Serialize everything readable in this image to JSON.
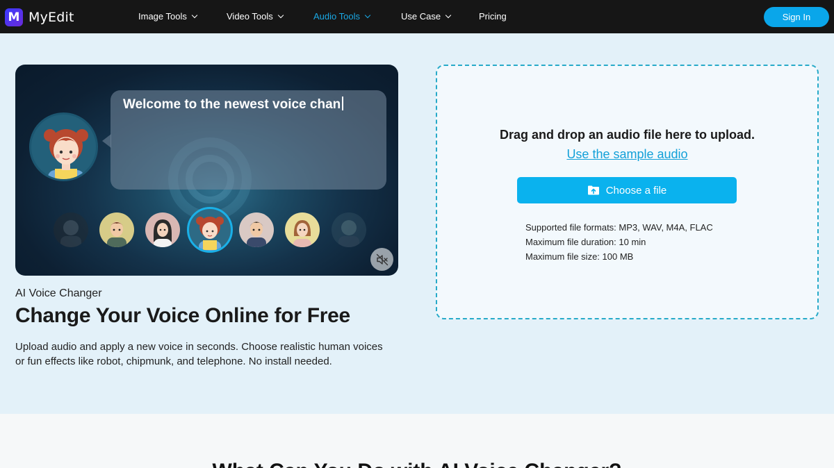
{
  "nav": {
    "logo_text": "MyEdit",
    "logo_letter": "M",
    "items": [
      {
        "label": "Image Tools"
      },
      {
        "label": "Video Tools"
      },
      {
        "label": "Audio Tools"
      },
      {
        "label": "Use Case"
      },
      {
        "label": "Pricing"
      }
    ],
    "active_item": "Audio Tools",
    "signin_label": "Sign In"
  },
  "video": {
    "bubble_text": "Welcome to the newest voice chan",
    "mute_icon": "speaker-muted-icon",
    "avatars": [
      "avatar-1",
      "avatar-2",
      "avatar-3",
      "avatar-4",
      "avatar-5",
      "avatar-6",
      "avatar-7"
    ],
    "selected_avatar": "avatar-4"
  },
  "hero": {
    "eyebrow": "AI Voice Changer",
    "headline": "Change Your Voice Online for Free",
    "description": "Upload audio and apply a new voice in seconds. Choose realistic human voices or fun effects like robot, chipmunk, and telephone. No install needed."
  },
  "upload": {
    "title": "Drag and drop an audio file here to upload.",
    "sample_link": "Use the sample audio",
    "choose_button": "Choose a file",
    "choose_icon": "folder-upload-icon",
    "specs": [
      "Supported file formats: MP3, WAV, M4A, FLAC",
      "Maximum file duration: 10 min",
      "Maximum file size: 100 MB"
    ]
  },
  "next_section": {
    "heading": "What Can You Do with AI Voice Changer?"
  },
  "colors": {
    "nav_bg": "#161616",
    "accent": "#0aa6ea",
    "hero_bg": "#e3f1f9",
    "upload_border": "#27aac9"
  }
}
